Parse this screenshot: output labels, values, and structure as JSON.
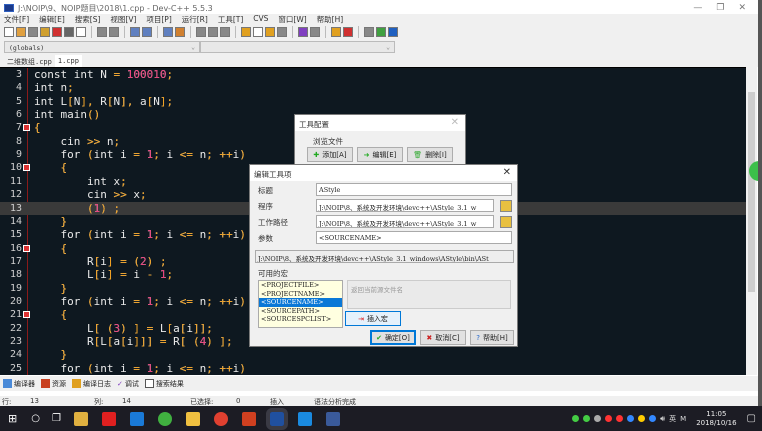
{
  "window": {
    "title": "J:\\NOIP\\9、NOIP题目\\2018\\1.cpp - Dev-C++ 5.5.3",
    "minimize": "—",
    "maximize": "❐",
    "close": "✕"
  },
  "menu": [
    "文件[F]",
    "编辑[E]",
    "搜索[S]",
    "视图[V]",
    "项目[P]",
    "运行[R]",
    "工具[T]",
    "CVS",
    "窗口[W]",
    "帮助[H]"
  ],
  "combos": {
    "scope": "(globals)",
    "symbol": ""
  },
  "tabs": [
    "二维数组.cpp",
    "1.cpp"
  ],
  "editor": {
    "current_line": 13,
    "lines": [
      {
        "n": 3,
        "text": "const int N = 100010;"
      },
      {
        "n": 4,
        "text": "int n;"
      },
      {
        "n": 5,
        "text": "int L[N], R[N], a[N];"
      },
      {
        "n": 6,
        "text": "int main()"
      },
      {
        "n": 7,
        "text": "{",
        "fold": true
      },
      {
        "n": 8,
        "text": "    cin >> n;"
      },
      {
        "n": 9,
        "text": "    for (int i = 1; i <= n; ++i)"
      },
      {
        "n": 10,
        "text": "    {",
        "fold": true
      },
      {
        "n": 11,
        "text": "        int x;"
      },
      {
        "n": 12,
        "text": "        cin >> x;"
      },
      {
        "n": 13,
        "text": "        (1) ;"
      },
      {
        "n": 14,
        "text": "    }"
      },
      {
        "n": 15,
        "text": "    for (int i = 1; i <= n; ++i)"
      },
      {
        "n": 16,
        "text": "    {",
        "fold": true
      },
      {
        "n": 17,
        "text": "        R[i] = (2) ;"
      },
      {
        "n": 18,
        "text": "        L[i] = i - 1;"
      },
      {
        "n": 19,
        "text": "    }"
      },
      {
        "n": 20,
        "text": "    for (int i = 1; i <= n; ++i)"
      },
      {
        "n": 21,
        "text": "    {",
        "fold": true
      },
      {
        "n": 22,
        "text": "        L[ (3) ] = L[a[i]];"
      },
      {
        "n": 23,
        "text": "        R[L[a[i]]] = R[ (4) ];"
      },
      {
        "n": 24,
        "text": "    }"
      },
      {
        "n": 25,
        "text": "    for (int i = 1; i <= n; ++i)"
      }
    ]
  },
  "bottom_tabs": [
    "编译器",
    "资源",
    "编译日志",
    "调试",
    "搜索结果"
  ],
  "status": {
    "row_label": "行:",
    "row": "13",
    "col_label": "列:",
    "col": "14",
    "sel_label": "已选择:",
    "sel": "0",
    "mode": "插入",
    "msg": "语法分析完成"
  },
  "tool_config": {
    "title": "工具配置",
    "group": "浏览文件",
    "add": "添加[A]",
    "edit": "编辑[E]",
    "delete": "删除[I]"
  },
  "edit_tool": {
    "title": "编辑工具项",
    "close": "✕",
    "title_label": "标题",
    "title_value": "AStyle",
    "program_label": "程序",
    "program_value": "J:\\NOIP\\8、系统及开发环境\\devc++\\AStyle_3.1_w",
    "workdir_label": "工作路径",
    "workdir_value": "J:\\NOIP\\8、系统及开发环境\\devc++\\AStyle_3.1_w",
    "params_label": "参数",
    "params_value": "<SOURCENAME>",
    "preview": "J:\\NOIP\\8、系统及开发环境\\devc++\\AStyle_3.1_windows\\AStyle\\bin\\ASt",
    "macros_label": "可用的宏",
    "macros": [
      "<PROJECTFILE>",
      "<PROJECTNAME>",
      "<SOURCENAME>",
      "<SOURCEPATH>",
      "<SOURCESPCLIST>"
    ],
    "selected_macro": 2,
    "macro_desc": "返回当前源文件名",
    "insert": "插入宏",
    "ok": "确定[O]",
    "cancel": "取消[C]",
    "help": "帮助[H]"
  },
  "taskbar": {
    "time": "11:05",
    "date": "2018/10/16",
    "ime": "英",
    "ime2": "M"
  },
  "colors": {
    "editor_bg": "#0e1820",
    "number": "#e8407a",
    "punct": "#f0a020",
    "selection": "#0a78d7"
  }
}
